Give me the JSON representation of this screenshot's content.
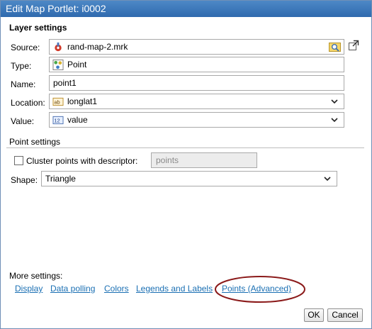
{
  "window": {
    "title": "Edit Map Portlet: i0002"
  },
  "layer_settings": {
    "heading": "Layer settings",
    "source_label": "Source:",
    "source_value": "rand-map-2.mrk",
    "type_label": "Type:",
    "type_value": "Point",
    "name_label": "Name:",
    "name_value": "point1",
    "location_label": "Location:",
    "location_value": "longlat1",
    "value_label": "Value:",
    "value_value": "value"
  },
  "point_settings": {
    "heading": "Point settings",
    "cluster_label": "Cluster points with descriptor:",
    "cluster_checked": false,
    "cluster_placeholder": "points",
    "shape_label": "Shape:",
    "shape_value": "Triangle"
  },
  "more_settings": {
    "heading": "More settings:",
    "links": [
      "Display",
      "Data polling",
      "Colors",
      "Legends and Labels",
      "Points (Advanced)"
    ]
  },
  "buttons": {
    "ok": "OK",
    "cancel": "Cancel"
  },
  "icons": {
    "source": "map-marker-icon",
    "browse": "folder-search-icon",
    "open_external": "open-external-icon",
    "type": "point-layer-icon",
    "location": "text-field-icon",
    "value": "numeric-field-icon",
    "dropdown": "chevron-down-icon"
  },
  "colors": {
    "titlebar": "#3b79bb",
    "link": "#1a6fb3",
    "highlight_ellipse": "#8b1a1a"
  }
}
